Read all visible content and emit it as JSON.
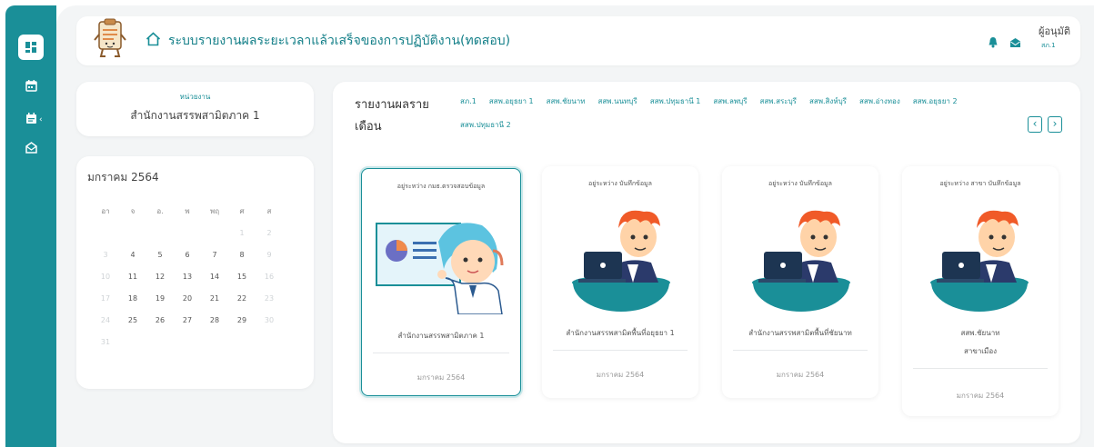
{
  "sidebar": {
    "items": [
      {
        "icon": "dashboard-icon"
      },
      {
        "icon": "calendar-icon"
      },
      {
        "icon": "calendar-menu-icon"
      },
      {
        "icon": "mail-icon"
      }
    ]
  },
  "header": {
    "title": "ระบบรายงานผลระยะเวลาแล้วเสร็จของการปฏิบัติงาน(ทดสอบ)",
    "user_name": "ผู้อนุมัติ",
    "user_role": "สภ.1"
  },
  "agency": {
    "label": "หน่วยงาน",
    "name": "สำนักงานสรรพสามิตภาค 1"
  },
  "calendar": {
    "title": "มกราคม 2564",
    "weekdays": [
      "อา",
      "จ",
      "อ.",
      "พ",
      "พฤ",
      "ศ",
      "ส"
    ],
    "days": [
      {
        "d": "",
        "dim": true
      },
      {
        "d": "",
        "dim": true
      },
      {
        "d": "",
        "dim": true
      },
      {
        "d": "",
        "dim": true
      },
      {
        "d": "",
        "dim": true
      },
      {
        "d": "1",
        "dim": true
      },
      {
        "d": "2",
        "dim": true
      },
      {
        "d": "3",
        "dim": true
      },
      {
        "d": "4"
      },
      {
        "d": "5"
      },
      {
        "d": "6"
      },
      {
        "d": "7"
      },
      {
        "d": "8"
      },
      {
        "d": "9",
        "dim": true
      },
      {
        "d": "10",
        "dim": true
      },
      {
        "d": "11"
      },
      {
        "d": "12"
      },
      {
        "d": "13"
      },
      {
        "d": "14"
      },
      {
        "d": "15"
      },
      {
        "d": "16",
        "dim": true
      },
      {
        "d": "17",
        "dim": true
      },
      {
        "d": "18"
      },
      {
        "d": "19"
      },
      {
        "d": "20"
      },
      {
        "d": "21"
      },
      {
        "d": "22"
      },
      {
        "d": "23",
        "dim": true
      },
      {
        "d": "24",
        "dim": true
      },
      {
        "d": "25"
      },
      {
        "d": "26"
      },
      {
        "d": "27"
      },
      {
        "d": "28"
      },
      {
        "d": "29"
      },
      {
        "d": "30",
        "dim": true
      },
      {
        "d": "31",
        "dim": true
      }
    ]
  },
  "report": {
    "title_line1": "รายงานผลราย",
    "title_line2": "เดือน",
    "tabs": [
      "สภ.1",
      "สสพ.อยุธยา 1",
      "สสพ.ชัยนาท",
      "สสพ.นนทบุรี",
      "สสพ.ปทุมธานี 1",
      "สสพ.ลพบุรี",
      "สสพ.สระบุรี",
      "สสพ.สิงห์บุรี",
      "สสพ.อ่างทอง",
      "สสพ.อยุธยา 2",
      "สสพ.ปทุมธานี 2"
    ],
    "prev_label": "‹",
    "next_label": "›",
    "cards": [
      {
        "status": "อยู่ระหว่าง กมธ.ตรวจสอบข้อมูล",
        "name": "สำนักงานสรรพสามิตภาค 1",
        "name2": "",
        "month": "มกราคม 2564",
        "illustration": "presenter-illustration"
      },
      {
        "status": "อยู่ระหว่าง บันทึกข้อมูล",
        "name": "สำนักงานสรรพสามิตพื้นที่อยุธยา 1",
        "name2": "",
        "month": "มกราคม 2564",
        "illustration": "laptop-worker-illustration"
      },
      {
        "status": "อยู่ระหว่าง บันทึกข้อมูล",
        "name": "สำนักงานสรรพสามิตพื้นที่ชัยนาท",
        "name2": "",
        "month": "มกราคม 2564",
        "illustration": "laptop-worker-illustration"
      },
      {
        "status": "อยู่ระหว่าง สาขา บันทึกข้อมูล",
        "name": "สสพ.ชัยนาท",
        "name2": "สาขาเมือง",
        "month": "มกราคม 2564",
        "illustration": "laptop-worker-illustration"
      }
    ]
  },
  "colors": {
    "primary": "#1a8f98",
    "background": "#f3f5f6"
  }
}
